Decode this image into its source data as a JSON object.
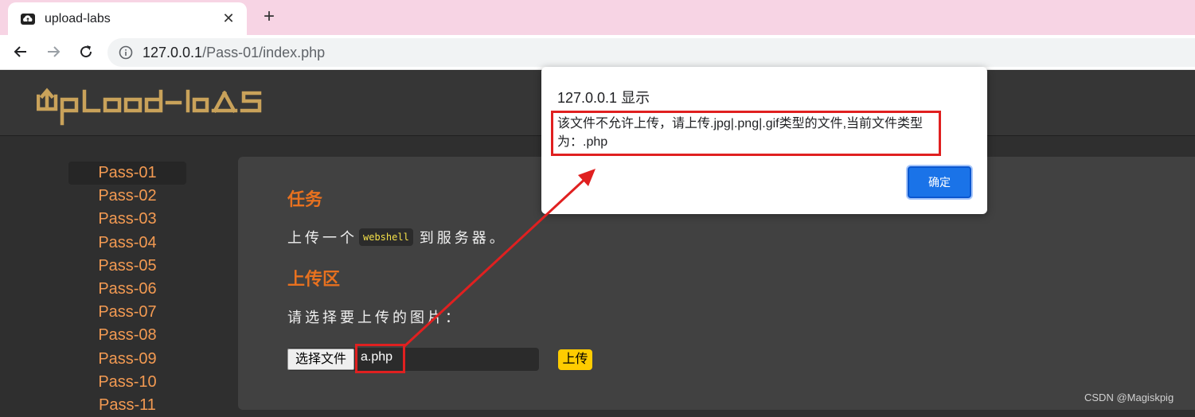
{
  "browser": {
    "tab_title": "upload-labs",
    "url_host": "127.0.0.1",
    "url_path": "/Pass-01/index.php"
  },
  "header": {
    "logo_text": "UpLoad-laBS"
  },
  "sidebar": {
    "items": [
      {
        "label": "Pass-01"
      },
      {
        "label": "Pass-02"
      },
      {
        "label": "Pass-03"
      },
      {
        "label": "Pass-04"
      },
      {
        "label": "Pass-05"
      },
      {
        "label": "Pass-06"
      },
      {
        "label": "Pass-07"
      },
      {
        "label": "Pass-08"
      },
      {
        "label": "Pass-09"
      },
      {
        "label": "Pass-10"
      },
      {
        "label": "Pass-11"
      }
    ],
    "active_index": 0
  },
  "main": {
    "task_heading": "任务",
    "task_prefix": "上传一个",
    "task_code": "webshell",
    "task_suffix": "到服务器。",
    "upload_heading": "上传区",
    "select_prompt": "请选择要上传的图片：",
    "choose_file_label": "选择文件",
    "file_name": "a.php",
    "upload_button_label": "上传"
  },
  "dialog": {
    "title": "127.0.0.1 显示",
    "message": "该文件不允许上传，请上传.jpg|.png|.gif类型的文件,当前文件类型为：.php",
    "ok_label": "确定"
  },
  "watermark": "CSDN @Magiskpig",
  "colors": {
    "accent_orange": "#e8711f",
    "sidebar_link": "#f39a52",
    "upload_button": "#ffcc00",
    "annotation_red": "#e02020",
    "dialog_button": "#1a73e8"
  }
}
